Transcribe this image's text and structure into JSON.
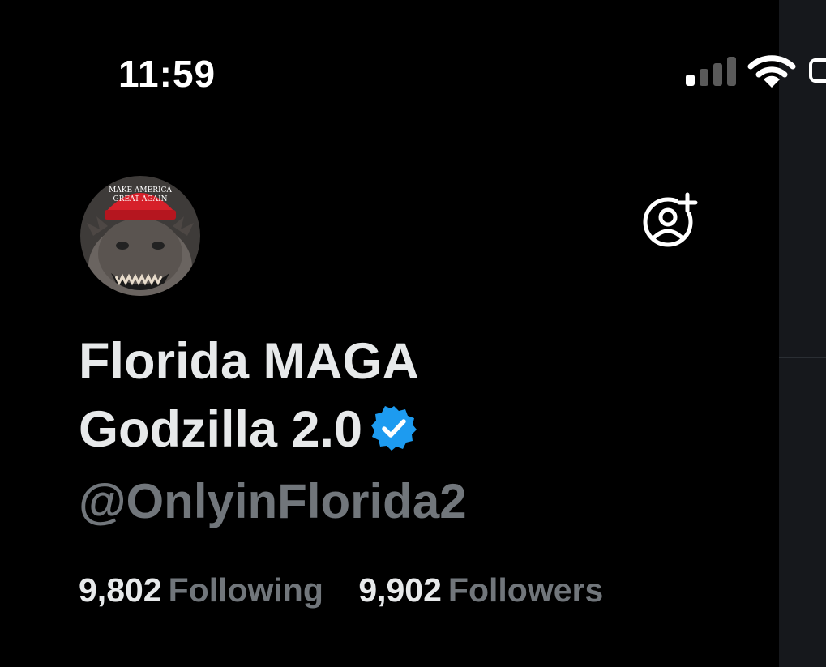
{
  "status_bar": {
    "time": "11:59",
    "signal_bars": 4,
    "signal_bars_active": 1,
    "wifi_icon": "wifi-icon",
    "battery_icon": "battery-icon"
  },
  "profile": {
    "avatar": {
      "icon": "avatar-godzilla-red-cap",
      "hat_text_line1": "MAKE AMERICA",
      "hat_text_line2": "GREAT AGAIN"
    },
    "display_name": "Florida MAGA Godzilla 2.0",
    "verified_icon": "verified-badge-icon",
    "handle": "@OnlyinFlorida2",
    "following_count": "9,802",
    "following_label": "Following",
    "followers_count": "9,902",
    "followers_label": "Followers"
  },
  "actions": {
    "add_account_icon": "add-account-icon"
  },
  "colors": {
    "background": "#000000",
    "side_panel": "#16181c",
    "name_text": "#e7e9ea",
    "secondary_text": "#71767b",
    "verified_blue": "#1d9bf0",
    "hat_red": "#d6202a"
  }
}
